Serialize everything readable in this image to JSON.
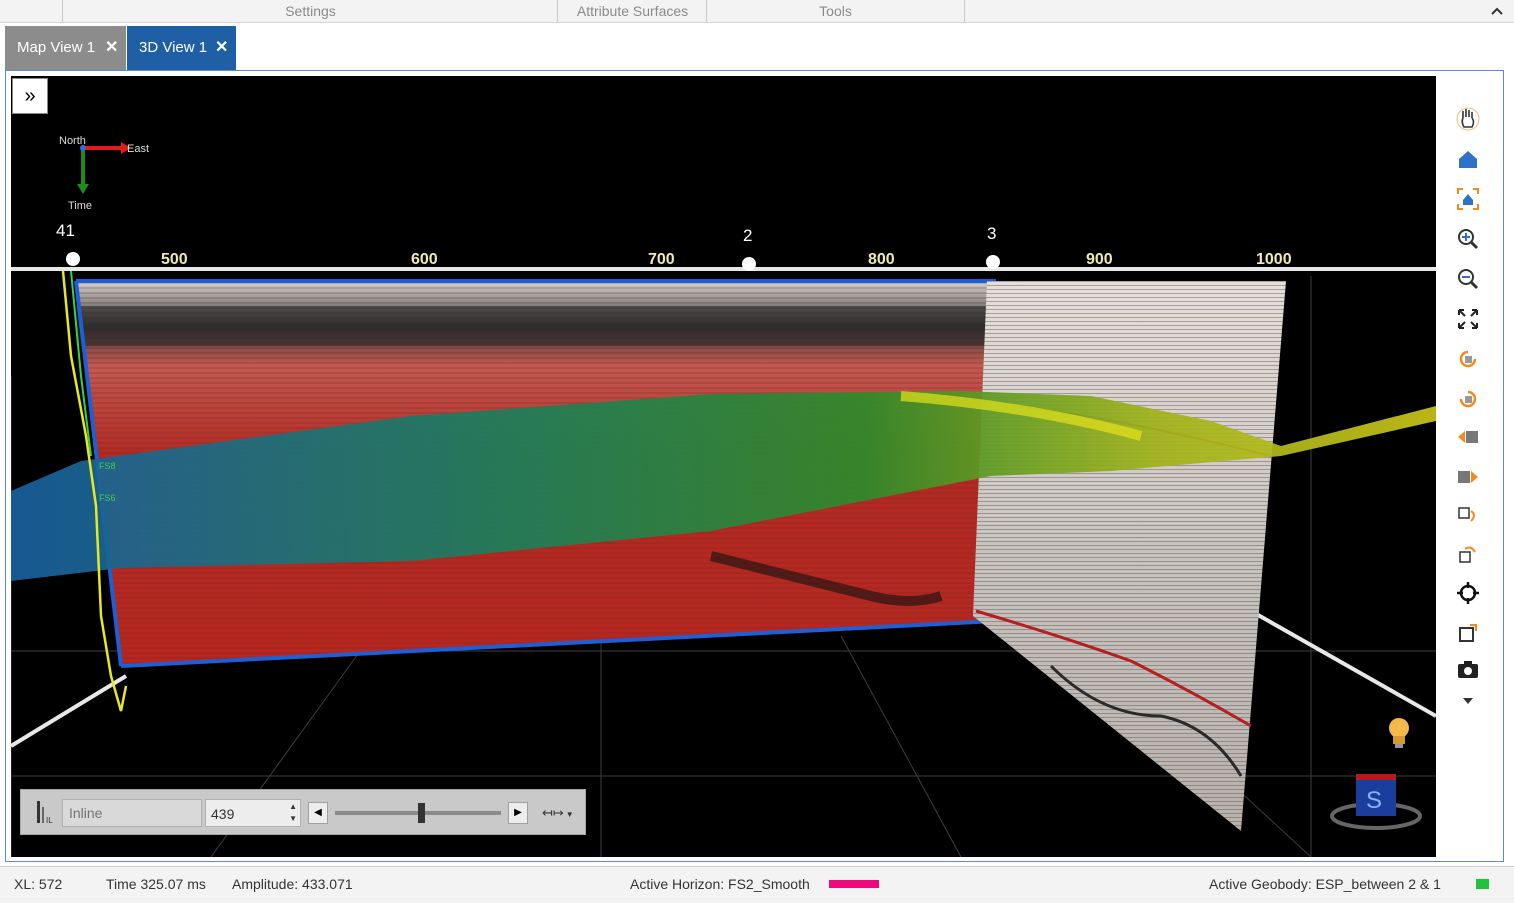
{
  "ribbon": {
    "groups": [
      "Settings",
      "Attribute Surfaces",
      "Tools"
    ],
    "collapse_icon": "chevron-up-icon"
  },
  "tabs": [
    {
      "label": "Map View 1",
      "active": false
    },
    {
      "label": "3D View 1",
      "active": true
    }
  ],
  "viewport": {
    "compass": {
      "north": "North",
      "east": "East",
      "time": "Time"
    },
    "well_labels": [
      "41",
      "2",
      "3"
    ],
    "axis_ticks": [
      "500",
      "600",
      "700",
      "800",
      "900",
      "1000"
    ],
    "horizon_labels": [
      "FS8",
      "FS6"
    ],
    "icons": [
      "expand-panel-icon",
      "lightbulb-icon",
      "view-cube-icon"
    ]
  },
  "toolbar": {
    "icons": [
      "pan-icon",
      "home-icon",
      "fit-view-icon",
      "zoom-in-icon",
      "zoom-out-icon",
      "fullscreen-icon",
      "rotate-icon",
      "rotate-reverse-icon",
      "move-left-icon",
      "move-right-icon",
      "slice-forward-icon",
      "slice-back-icon",
      "center-icon",
      "crop-icon",
      "camera-icon",
      "more-icon"
    ]
  },
  "slice_control": {
    "type_placeholder": "Inline",
    "value": "439",
    "slider_fraction": 0.52
  },
  "status_bar": {
    "xl": "XL: 572",
    "time": "Time 325.07 ms",
    "amplitude": "Amplitude: 433.071",
    "active_horizon": "Active Horizon: FS2_Smooth",
    "horizon_color": "#ee0a7a",
    "active_geobody": "Active Geobody: ESP_between  2  &  1",
    "geobody_color": "#1fc43a"
  },
  "colors": {
    "active_tab": "#1f5fa6",
    "inactive_tab": "#8c8c8c",
    "frame_border": "#5b8bc9",
    "toolbar_orange": "#f28a1e",
    "toolbar_blue": "#2f72c6"
  }
}
